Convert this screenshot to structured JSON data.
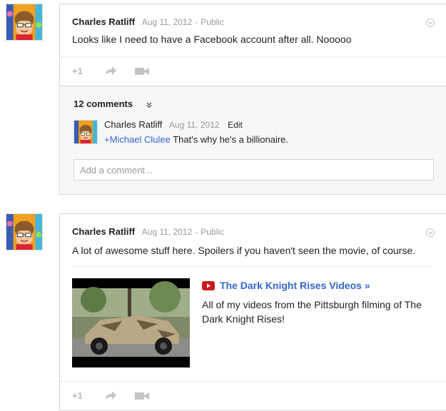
{
  "post1": {
    "author": "Charles Ratliff",
    "date": "Aug 11, 2012",
    "separator": "-",
    "visibility": "Public",
    "text": "Looks like I need to have a Facebook account after all. Nooooo",
    "actions": {
      "plus_one": "+1",
      "share_icon": "share-icon",
      "hangout_icon": "video-camera-icon"
    }
  },
  "comments": {
    "count_label": "12 comments",
    "comment": {
      "author": "Charles Ratliff",
      "date": "Aug 11, 2012",
      "edit_label": "Edit",
      "mention": "+Michael Clulee",
      "text": " That's why he's a billionaire."
    },
    "input_placeholder": "Add a comment..."
  },
  "post2": {
    "author": "Charles Ratliff",
    "date": "Aug 11, 2012",
    "separator": "-",
    "visibility": "Public",
    "text": "A lot of awesome stuff here. Spoilers if you haven't seen the movie, of course.",
    "attachment": {
      "title": "The Dark Knight Rises Videos »",
      "description": "All of my videos from the Pittsburgh filming of The Dark Knight Rises!"
    },
    "actions": {
      "plus_one": "+1",
      "share_icon": "share-icon",
      "hangout_icon": "video-camera-icon"
    }
  },
  "colors": {
    "link": "#3366cc",
    "muted": "#999999",
    "youtube_red": "#cc181e"
  }
}
